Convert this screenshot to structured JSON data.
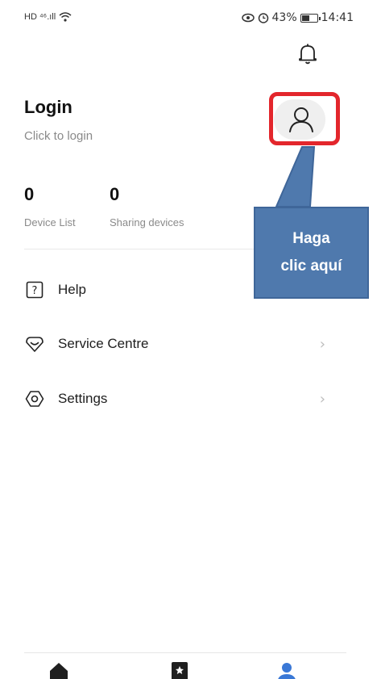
{
  "status_bar": {
    "left_text": "HD ⁴⁶.ıll",
    "battery_percent": "43%",
    "time": "14:41"
  },
  "header": {
    "login_title": "Login",
    "login_subtitle": "Click to login"
  },
  "stats": [
    {
      "value": "0",
      "label": "Device List"
    },
    {
      "value": "0",
      "label": "Sharing devices"
    }
  ],
  "menu": [
    {
      "label": "Help",
      "icon": "question-box-icon"
    },
    {
      "label": "Service Centre",
      "icon": "heart-diamond-icon"
    },
    {
      "label": "Settings",
      "icon": "settings-hex-icon"
    }
  ],
  "callout": {
    "line1": "Haga",
    "line2": "clic aquí"
  },
  "bottom_nav": [
    {
      "icon": "home-icon"
    },
    {
      "icon": "scene-icon"
    },
    {
      "icon": "profile-icon",
      "active": true
    }
  ],
  "colors": {
    "highlight_border": "#e3262c",
    "callout_fill": "#4f79ad",
    "active_nav": "#3a78d6"
  }
}
